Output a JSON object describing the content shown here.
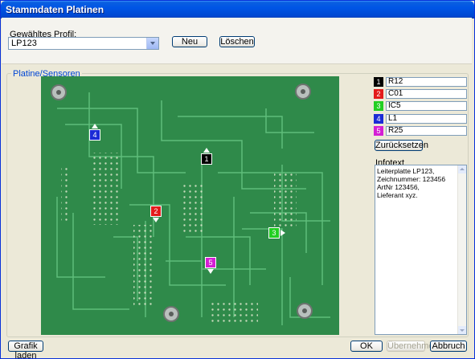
{
  "window": {
    "title": "Stammdaten Platinen"
  },
  "profile": {
    "label": "Gewähltes Profil:",
    "value": "LP123",
    "new_label": "Neu",
    "delete_label": "Löschen"
  },
  "group": {
    "label": "Platine/Sensoren"
  },
  "sensors": [
    {
      "index": "1",
      "name": "R12",
      "color": "#000000"
    },
    {
      "index": "2",
      "name": "C01",
      "color": "#e31b1b"
    },
    {
      "index": "3",
      "name": "IC5",
      "color": "#22cf22"
    },
    {
      "index": "4",
      "name": "L1",
      "color": "#1b2bd6"
    },
    {
      "index": "5",
      "name": "R25",
      "color": "#d41fd4"
    }
  ],
  "reset_label": "Zurücksetzen",
  "info": {
    "label": "Infotext",
    "text": "Leiterplatte LP123,\nZeichnummer: 123456\nArtNr 123456,\nLieferant xyz."
  },
  "buttons": {
    "load": "Grafik laden",
    "ok": "OK",
    "apply": "Übernehmen",
    "cancel": "Abbruch"
  }
}
